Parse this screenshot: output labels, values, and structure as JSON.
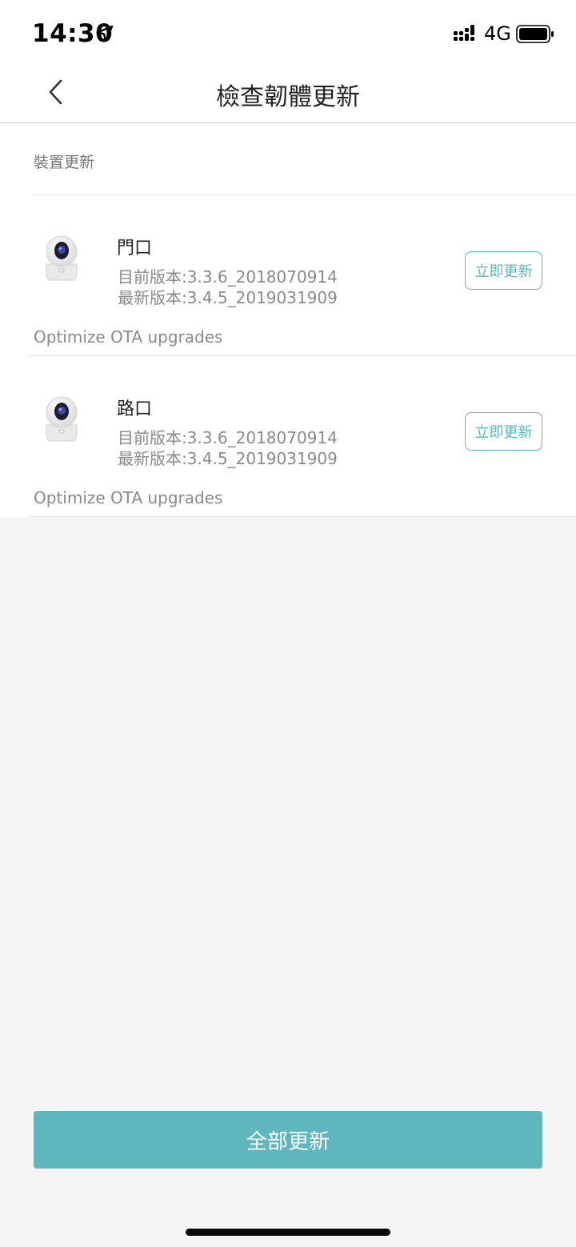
{
  "status_bar": {
    "time": "14:30",
    "network": "4G",
    "icons": [
      "location-arrow-icon",
      "signal-icon",
      "battery-icon"
    ]
  },
  "nav": {
    "title": "檢查韌體更新",
    "back_icon": "chevron-left-icon"
  },
  "section": {
    "header": "裝置更新"
  },
  "devices": [
    {
      "name": "門口",
      "current_version": "目前版本:3.3.6_2018070914",
      "latest_version": "最新版本:3.4.5_2019031909",
      "button_label": "立即更新",
      "release_note": "Optimize OTA upgrades",
      "icon": "camera-icon"
    },
    {
      "name": "路口",
      "current_version": "目前版本:3.3.6_2018070914",
      "latest_version": "最新版本:3.4.5_2019031909",
      "button_label": "立即更新",
      "release_note": "Optimize OTA upgrades",
      "icon": "camera-icon"
    }
  ],
  "update_all_label": "全部更新",
  "colors": {
    "accent": "#5fb7bd",
    "background": "#f4f4f4",
    "card": "#ffffff"
  }
}
